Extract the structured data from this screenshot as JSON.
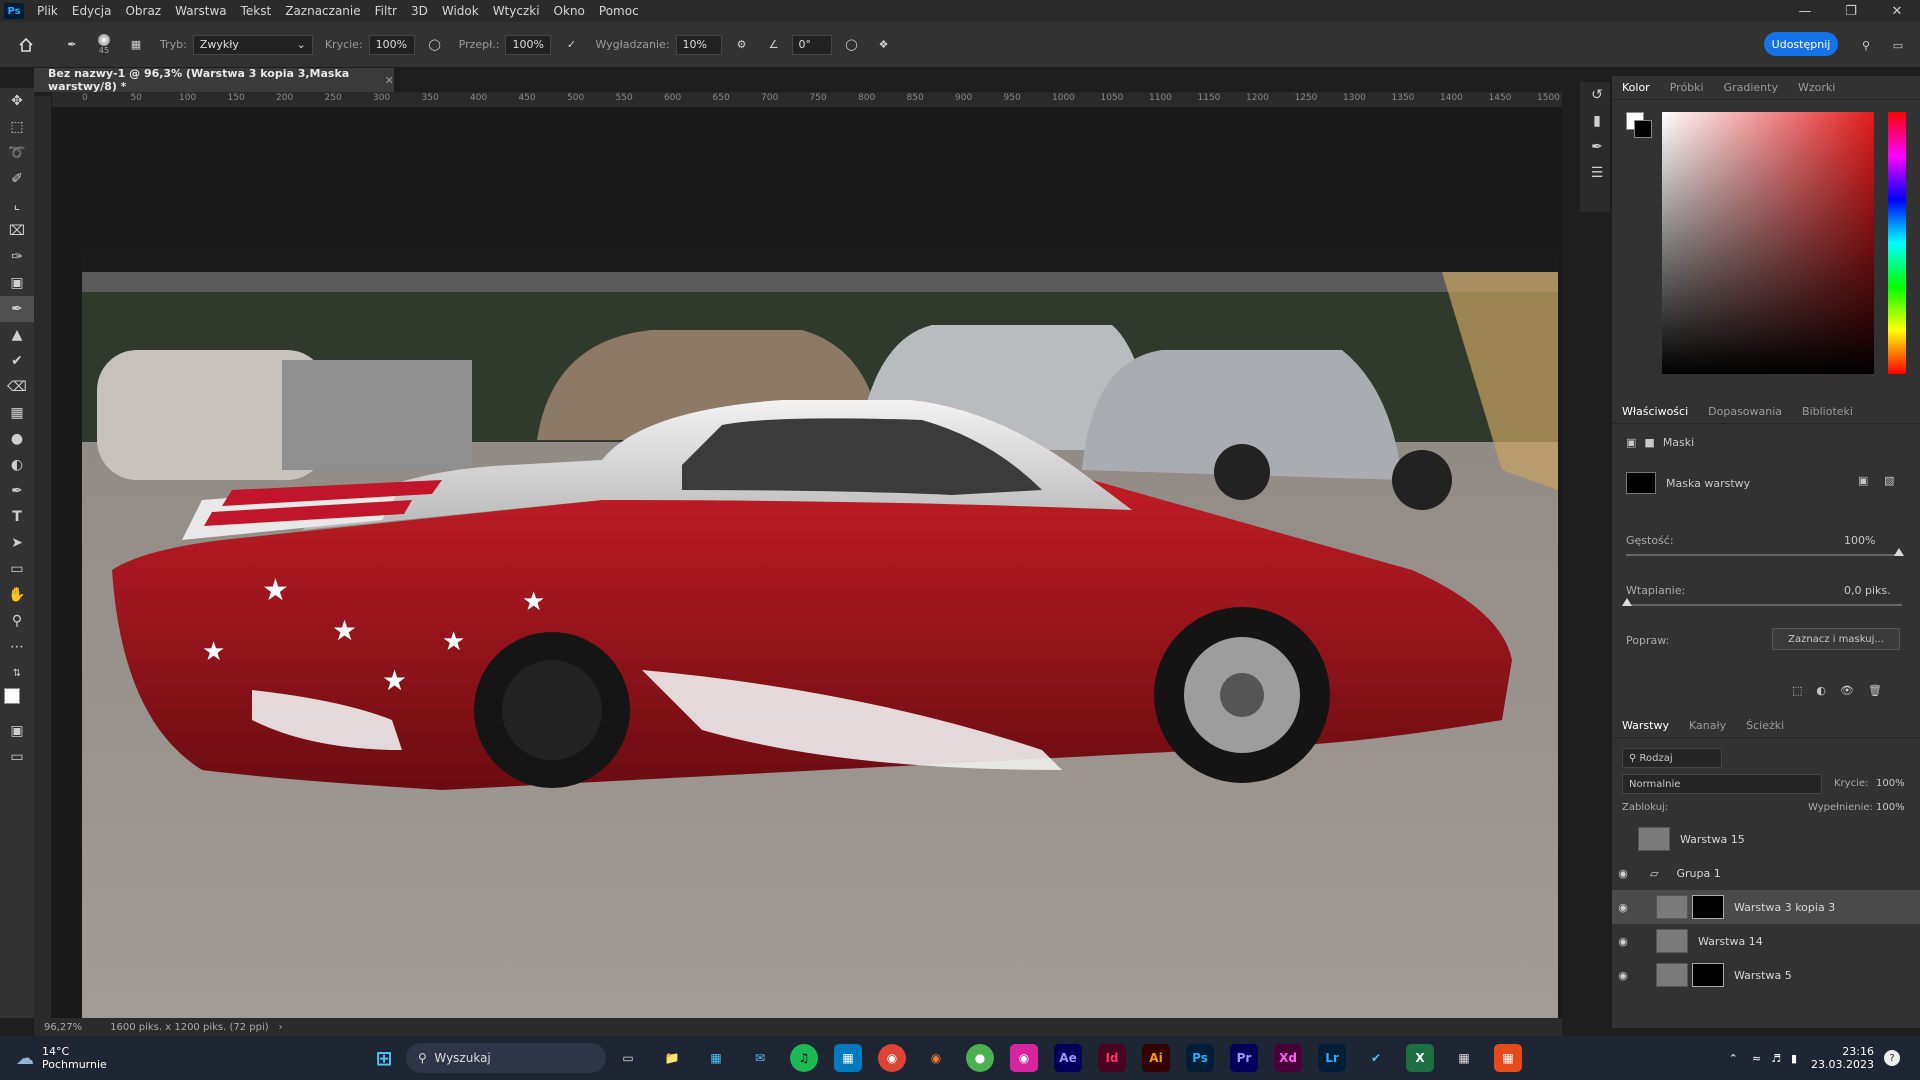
{
  "menubar": {
    "app_logo": "Ps",
    "items": [
      "Plik",
      "Edycja",
      "Obraz",
      "Warstwa",
      "Tekst",
      "Zaznaczanie",
      "Filtr",
      "3D",
      "Widok",
      "Wtyczki",
      "Okno",
      "Pomoc"
    ]
  },
  "options": {
    "brush_size": "45",
    "mode_label": "Tryb:",
    "mode_value": "Zwykły",
    "opacity_label": "Krycie:",
    "opacity_value": "100%",
    "flow_label": "Przepł.:",
    "flow_value": "100%",
    "smoothing_label": "Wygładzanie:",
    "smoothing_value": "10%",
    "angle_value": "0°",
    "share_label": "Udostępnij"
  },
  "document": {
    "tab_title": "Bez nazwy-1 @ 96,3% (Warstwa 3 kopia 3,Maska warstwy/8) *",
    "ruler_ticks": [
      "0",
      "50",
      "100",
      "150",
      "200",
      "250",
      "300",
      "350",
      "400",
      "450",
      "500",
      "550",
      "600",
      "650",
      "700",
      "750",
      "800",
      "850",
      "900",
      "950",
      "1000",
      "1050",
      "1100",
      "1150",
      "1200",
      "1250",
      "1300",
      "1350",
      "1400",
      "1450",
      "1500"
    ],
    "zoom": "96,27%",
    "doc_info": "1600 piks. x 1200 piks. (72 ppi)"
  },
  "color_panel": {
    "tabs": [
      "Kolor",
      "Próbki",
      "Gradienty",
      "Wzorki"
    ],
    "hue_color": "#e31b1b"
  },
  "properties_panel": {
    "tabs": [
      "Właściwości",
      "Dopasowania",
      "Biblioteki"
    ],
    "masks_label": "Maski",
    "layer_mask_label": "Maska warstwy",
    "density_label": "Gęstość:",
    "density_value": "100%",
    "feather_label": "Wtapianie:",
    "feather_value": "0,0 piks.",
    "refine_label": "Popraw:",
    "select_mask_button": "Zaznacz i maskuj..."
  },
  "layers_panel": {
    "tabs": [
      "Warstwy",
      "Kanały",
      "Ścieżki"
    ],
    "filter_value": "Rodzaj",
    "blend_mode": "Normalnie",
    "opacity_label": "Krycie:",
    "opacity_value": "100%",
    "lock_label": "Zablokuj:",
    "fill_label": "Wypełnienie:",
    "fill_value": "100%",
    "layers": [
      {
        "name": "Warstwa 15",
        "visible": false,
        "indent": false
      },
      {
        "name": "Grupa 1",
        "visible": true,
        "indent": false
      },
      {
        "name": "Warstwa 3 kopia 3",
        "visible": true,
        "indent": true
      },
      {
        "name": "Warstwa 14",
        "visible": true,
        "indent": true
      },
      {
        "name": "Warstwa 5",
        "visible": true,
        "indent": true
      }
    ]
  },
  "taskbar": {
    "weather_temp": "14°C",
    "weather_desc": "Pochmurnie",
    "search_placeholder": "Wyszukaj",
    "apps": [
      {
        "label": "Ae",
        "color": "#9999ff",
        "bg": "#00005b"
      },
      {
        "label": "Id",
        "color": "#ff3366",
        "bg": "#49021f"
      },
      {
        "label": "Ai",
        "color": "#ff9a00",
        "bg": "#330000"
      },
      {
        "label": "Ps",
        "color": "#31a8ff",
        "bg": "#001e36"
      },
      {
        "label": "Pr",
        "color": "#9999ff",
        "bg": "#00005b"
      },
      {
        "label": "Xd",
        "color": "#ff61f6",
        "bg": "#470137"
      },
      {
        "label": "Lr",
        "color": "#31a8ff",
        "bg": "#001e36"
      }
    ],
    "time": "23:16",
    "date": "23.03.2023"
  }
}
